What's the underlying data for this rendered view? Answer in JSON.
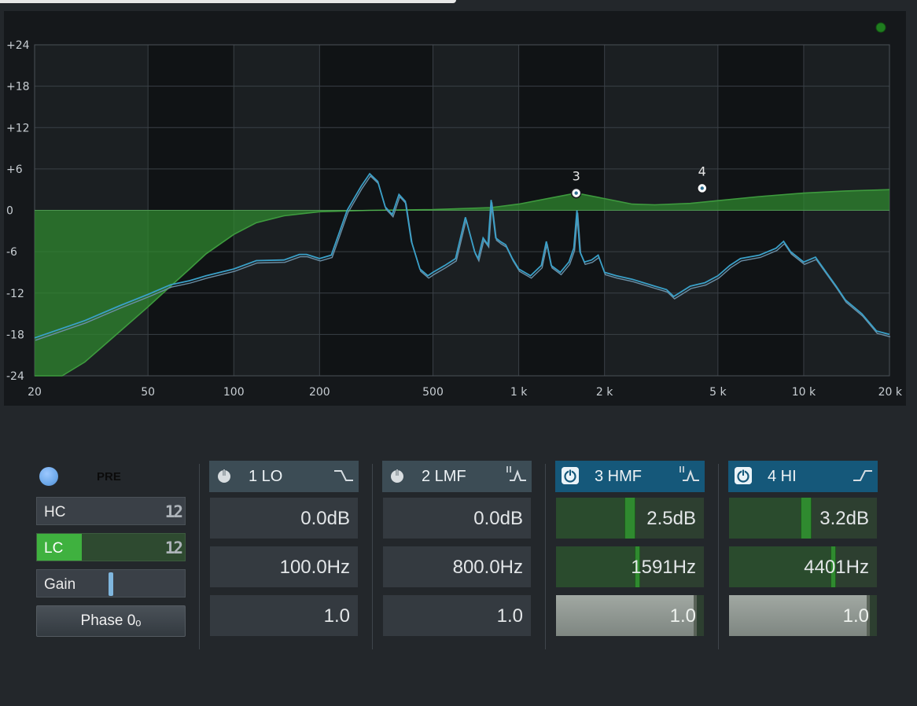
{
  "graph": {
    "y_labels": [
      "+24",
      "+18",
      "+12",
      "+6",
      "0",
      "-6",
      "-12",
      "-18",
      "-24"
    ],
    "x_labels": [
      "20",
      "50",
      "100",
      "200",
      "500",
      "1 k",
      "2 k",
      "5 k",
      "10 k",
      "20 k"
    ],
    "markers": [
      {
        "label": "3",
        "freq_hz": 1591,
        "gain_db": 2.5
      },
      {
        "label": "4",
        "freq_hz": 4401,
        "gain_db": 3.2
      }
    ],
    "colors": {
      "eq_fill": "#2f8a2f",
      "eq_line": "#3e9a3e",
      "spectrum": "#3aa0c8",
      "grid": "#3a4046",
      "background": "#15181b",
      "indicator": "#1f7d1f"
    }
  },
  "chart_data": {
    "type": "line",
    "title": "",
    "xlabel": "",
    "ylabel": "",
    "x_scale": "log",
    "xlim": [
      20,
      20000
    ],
    "ylim": [
      -24,
      24
    ],
    "x_ticks": [
      20,
      50,
      100,
      200,
      500,
      1000,
      2000,
      5000,
      10000,
      20000
    ],
    "y_ticks": [
      24,
      18,
      12,
      6,
      0,
      -6,
      -12,
      -18,
      -24
    ],
    "grid": true,
    "series": [
      {
        "kind": "eq_curve",
        "x": [
          20,
          25,
          30,
          40,
          50,
          60,
          70,
          80,
          100,
          120,
          150,
          200,
          300,
          500,
          800,
          1000,
          1300,
          1591,
          2000,
          2500,
          3000,
          4000,
          5000,
          7000,
          10000,
          14000,
          20000
        ],
        "y": [
          -24,
          -24,
          -22,
          -17.5,
          -14,
          -11,
          -8.5,
          -6.3,
          -3.5,
          -1.8,
          -0.8,
          -0.2,
          0,
          0.1,
          0.4,
          0.9,
          1.8,
          2.5,
          1.7,
          0.9,
          0.8,
          1.0,
          1.4,
          2.0,
          2.5,
          2.8,
          3.0
        ]
      },
      {
        "kind": "spectrum",
        "x": [
          20,
          30,
          40,
          50,
          60,
          70,
          80,
          100,
          120,
          150,
          170,
          180,
          200,
          220,
          250,
          280,
          300,
          320,
          340,
          360,
          380,
          400,
          420,
          450,
          480,
          500,
          550,
          600,
          650,
          700,
          720,
          750,
          780,
          800,
          830,
          860,
          900,
          950,
          1000,
          1100,
          1200,
          1250,
          1300,
          1400,
          1500,
          1560,
          1600,
          1640,
          1700,
          1800,
          1900,
          2000,
          2200,
          2500,
          3000,
          3300,
          3500,
          4000,
          4500,
          5000,
          5500,
          6000,
          7000,
          8000,
          8500,
          9000,
          10000,
          11000,
          12000,
          13000,
          14000,
          16000,
          18000,
          20000
        ],
        "y": [
          -18.5,
          -16,
          -13.8,
          -12.2,
          -10.8,
          -10.2,
          -9.5,
          -8.5,
          -7.3,
          -7.2,
          -6.4,
          -6.4,
          -7,
          -6.5,
          0,
          3.5,
          5.3,
          4.2,
          0.5,
          -0.6,
          2.3,
          1.3,
          -4.5,
          -8.5,
          -9.5,
          -9,
          -8,
          -7,
          -1,
          -6,
          -7,
          -4,
          -5,
          1.5,
          -4,
          -4.5,
          -5,
          -7,
          -8.5,
          -9.5,
          -8,
          -4.5,
          -8,
          -9,
          -7.5,
          -5.5,
          0,
          -6,
          -7.5,
          -7.2,
          -6.5,
          -9,
          -9.5,
          -10,
          -11,
          -11.5,
          -12.5,
          -11,
          -10.5,
          -9.5,
          -8,
          -7,
          -6.5,
          -5.5,
          -4.5,
          -6,
          -7.5,
          -6.8,
          -9,
          -11,
          -13,
          -15,
          -17.5,
          -18
        ]
      }
    ]
  },
  "controls": {
    "pre_label": "PRE",
    "hc_label": "HC",
    "hc_slope": "12",
    "lc_label": "LC",
    "lc_slope": "12",
    "gain_label": "Gain",
    "gain_level": 0.5,
    "phase_label": "Phase 0ₒ"
  },
  "bands": [
    {
      "name": "1 LO",
      "enabled": false,
      "shape_icon": "low-shelf-icon",
      "gain": "0.0dB",
      "freq": "100.0Hz",
      "q": "1.0"
    },
    {
      "name": "2 LMF",
      "enabled": false,
      "shape_icon": "peak-filter-icon",
      "gain": "0.0dB",
      "freq": "800.0Hz",
      "q": "1.0"
    },
    {
      "name": "3 HMF",
      "enabled": true,
      "shape_icon": "peak-filter-icon",
      "gain": "2.5dB",
      "freq": "1591Hz",
      "q": "1.0",
      "gain_level": 0.5,
      "freq_level": 0.55,
      "q_level": 0.95
    },
    {
      "name": "4 HI",
      "enabled": true,
      "shape_icon": "high-shelf-icon",
      "gain": "3.2dB",
      "freq": "4401Hz",
      "q": "1.0",
      "gain_level": 0.52,
      "freq_level": 0.7,
      "q_level": 0.95
    }
  ]
}
